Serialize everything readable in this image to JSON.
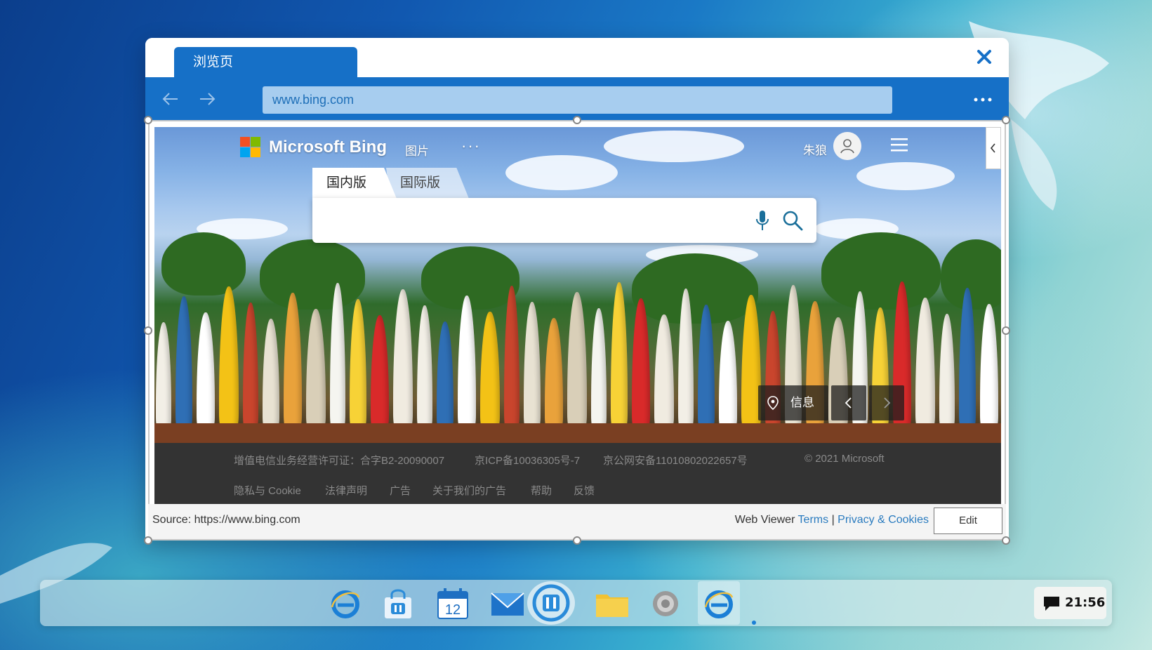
{
  "browser": {
    "tab_label": "浏览页",
    "url": "www.bing.com",
    "icons": {
      "close": "close-icon",
      "back": "arrow-left-icon",
      "forward": "arrow-right-icon",
      "more": "more-horizontal-icon"
    },
    "accent_color": "#1670c7"
  },
  "bing": {
    "logo_text": "Microsoft Bing",
    "nav_images": "图片",
    "nav_more": "···",
    "user_name": "朱狼",
    "scope_tabs": [
      "国内版",
      "国际版"
    ],
    "search_placeholder": "",
    "info_label": "信息",
    "footer_row1": [
      "增值电信业务经营许可证：合字B2-20090007",
      "京ICP备10036305号-7",
      "京公网安备11010802022657号",
      "© 2021 Microsoft"
    ],
    "footer_row2": [
      "隐私与 Cookie",
      "法律声明",
      "广告",
      "关于我们的广告",
      "帮助",
      "反馈"
    ]
  },
  "viewer": {
    "source": "Source: https://www.bing.com",
    "web_viewer": "Web Viewer",
    "terms": "Terms",
    "separator": "|",
    "privacy": "Privacy & Cookies",
    "edit": "Edit"
  },
  "taskbar": {
    "apps": [
      "browser",
      "store",
      "calendar",
      "mail",
      "hub",
      "files",
      "settings",
      "browser-active"
    ],
    "calendar_day": "12",
    "time": "21:56"
  }
}
